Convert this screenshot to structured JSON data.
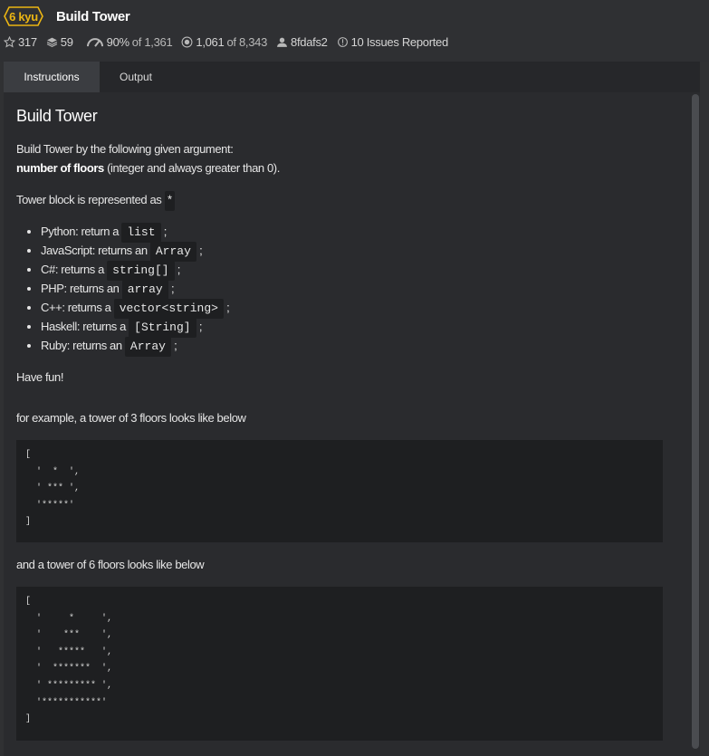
{
  "header": {
    "kyu": "6 kyu",
    "title": "Build Tower",
    "stats": {
      "stars": "317",
      "collections": "59",
      "satisfaction": "90%",
      "satisfaction_of": "of 1,361",
      "completed": "1,061",
      "completed_of": "of 8,343",
      "author": "8fdafs2",
      "issues": "10 Issues Reported"
    }
  },
  "tabs": {
    "instructions": "Instructions",
    "output": "Output"
  },
  "description": {
    "title": "Build Tower",
    "intro_line1": "Build Tower by the following given argument:",
    "intro_bold": "number of floors",
    "intro_rest": " (integer and always greater than 0).",
    "block_text": "Tower block is represented as ",
    "block_char": "*",
    "languages": [
      {
        "text": "Python: return a ",
        "code": "list"
      },
      {
        "text": "JavaScript: returns an ",
        "code": "Array"
      },
      {
        "text": "C#: returns a ",
        "code": "string[]"
      },
      {
        "text": "PHP: returns an ",
        "code": "array"
      },
      {
        "text": "C++: returns a ",
        "code": "vector<string>"
      },
      {
        "text": "Haskell: returns a ",
        "code": "[String]"
      },
      {
        "text": "Ruby: returns an ",
        "code": "Array"
      }
    ],
    "semicolon": ";",
    "have_fun": "Have fun!",
    "example3_text": "for example, a tower of 3 floors looks like below",
    "example3_code": "[\n  '  *  ',\n  ' *** ',\n  '*****'\n]",
    "example6_text": "and a tower of 6 floors looks like below",
    "example6_code": "[\n  '     *     ',\n  '    ***    ',\n  '   *****   ',\n  '  *******  ',\n  ' ********* ',\n  '***********'\n]"
  },
  "colors": {
    "kyu_yellow": "#ecb613",
    "background": "#303133",
    "panel": "#2a2b2e",
    "code_bg": "#1e1f21"
  }
}
